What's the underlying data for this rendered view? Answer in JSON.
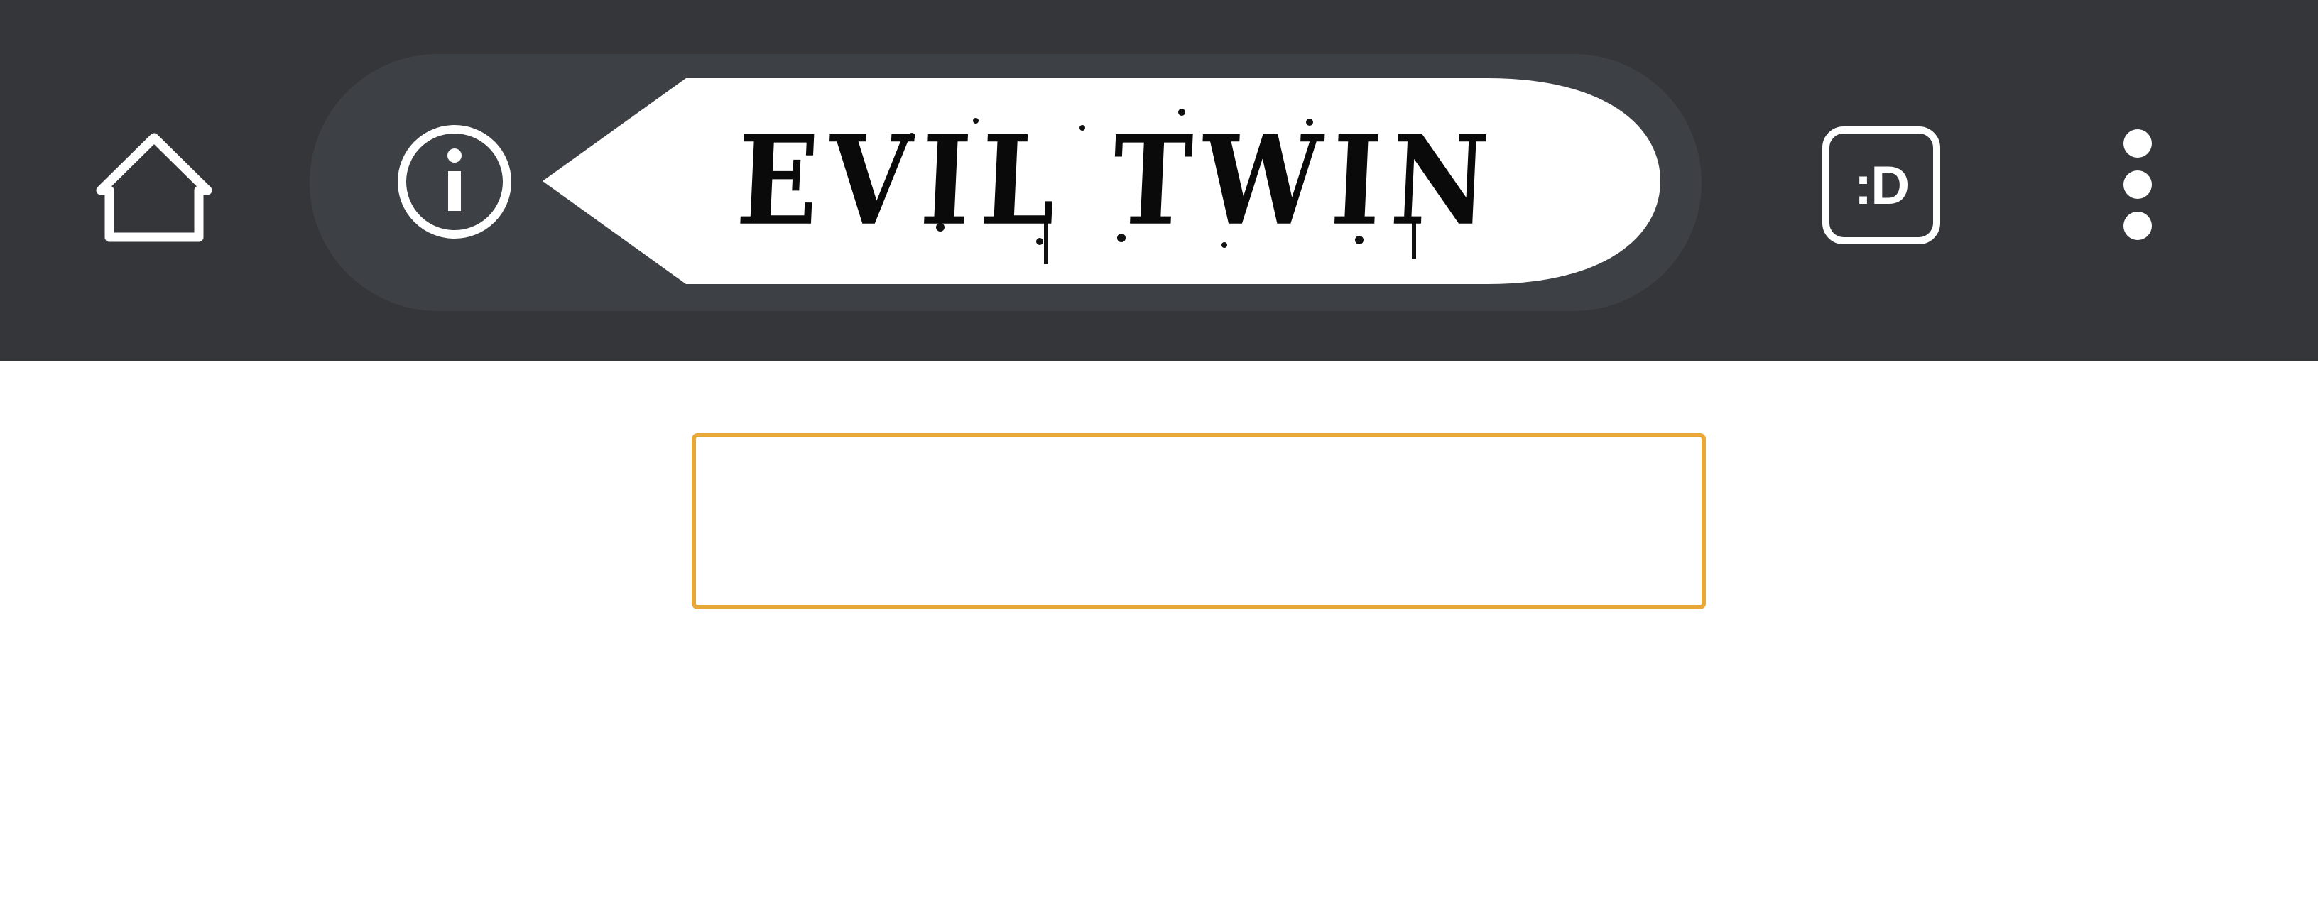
{
  "toolbar": {
    "home_icon": "home-icon",
    "info_icon": "info-icon",
    "menu_icon": "more-vert-icon",
    "background_color": "#35363a",
    "omnibox_color": "#3d4145"
  },
  "omnibox": {
    "title_logo_text": "EVIL TWIN"
  },
  "tab_switcher": {
    "label": ":D"
  },
  "content": {
    "search_input": {
      "value": "",
      "placeholder": "",
      "border_color": "#e8a838"
    }
  }
}
